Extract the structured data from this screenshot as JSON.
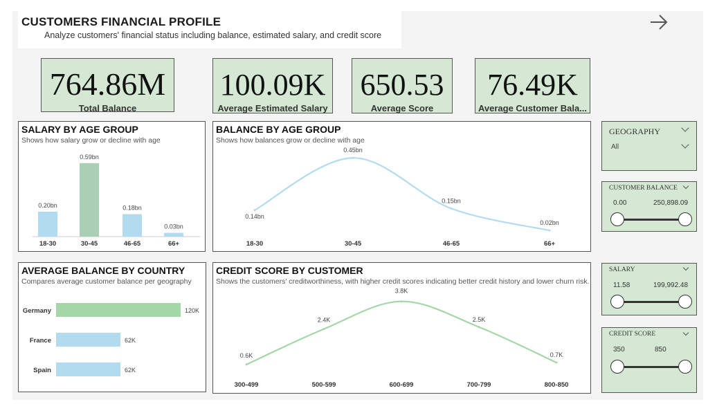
{
  "header": {
    "title": "CUSTOMERS FINANCIAL PROFILE",
    "subtitle": "Analyze customers' financial status including balance, estimated salary, and credit score"
  },
  "kpis": [
    {
      "value": "764.86M",
      "label": "Total Balance"
    },
    {
      "value": "100.09K",
      "label": "Average Estimated Salary"
    },
    {
      "value": "650.53",
      "label": "Average Score"
    },
    {
      "value": "76.49K",
      "label": "Average Customer Bala..."
    }
  ],
  "salary_panel": {
    "title": "SALARY BY AGE GROUP",
    "subtitle": "Shows how salary grow or decline with age"
  },
  "balance_age_panel": {
    "title": "BALANCE BY AGE GROUP",
    "subtitle": "Shows how balances grow or decline with age"
  },
  "country_panel": {
    "title": "AVERAGE BALANCE BY COUNTRY",
    "subtitle": "Compares average customer balance per geography"
  },
  "credit_panel": {
    "title": "CREDIT SCORE BY CUSTOMER",
    "subtitle": "Shows the customers' creditworthiness, with higher credit scores indicating better credit history and lower churn risk."
  },
  "colors": {
    "green_panel": "#d5e8d4",
    "bar_blue": "#b3dbf0",
    "bar_green": "#a9d0b5",
    "line_blue": "#b3dbf0",
    "line_green": "#a5d6a7",
    "country_green": "#a5d6a7"
  },
  "chart_data": [
    {
      "type": "bar",
      "categories": [
        "18-30",
        "30-45",
        "46-65",
        "66+"
      ],
      "values": [
        0.2,
        0.59,
        0.18,
        0.03
      ],
      "labels": [
        "0.20bn",
        "0.59bn",
        "0.18bn",
        "0.03bn"
      ],
      "highlight_index": 1,
      "ylim": [
        0,
        0.6
      ]
    },
    {
      "type": "line",
      "categories": [
        "18-30",
        "30-45",
        "46-65",
        "66+"
      ],
      "values": [
        0.14,
        0.45,
        0.15,
        0.02
      ],
      "labels": [
        "0.14bn",
        "0.45bn",
        "0.15bn",
        "0.02bn"
      ],
      "ylim": [
        0,
        0.5
      ]
    },
    {
      "type": "bar",
      "orientation": "horizontal",
      "categories": [
        "Germany",
        "France",
        "Spain"
      ],
      "values": [
        120,
        62,
        62
      ],
      "labels": [
        "120K",
        "62K",
        "62K"
      ],
      "xlim": [
        0,
        120
      ]
    },
    {
      "type": "line",
      "categories": [
        "300-499",
        "500-599",
        "600-699",
        "700-799",
        "800-850"
      ],
      "values": [
        0.6,
        2.4,
        3.8,
        2.5,
        0.7
      ],
      "labels": [
        "0.6K",
        "2.4K",
        "3.8K",
        "2.5K",
        "0.7K"
      ],
      "ylim": [
        0,
        4
      ]
    }
  ],
  "slicers": {
    "geography": {
      "label": "GEOGRAPHY",
      "value": "All"
    },
    "customer_balance": {
      "label": "CUSTOMER BALANCE",
      "min": "0.00",
      "max": "250,898.09"
    },
    "salary": {
      "label": "SALARY",
      "min": "11.58",
      "max": "199,992.48"
    },
    "credit_score": {
      "label": "CREDIT SCORE",
      "min": "350",
      "max": "850"
    }
  }
}
